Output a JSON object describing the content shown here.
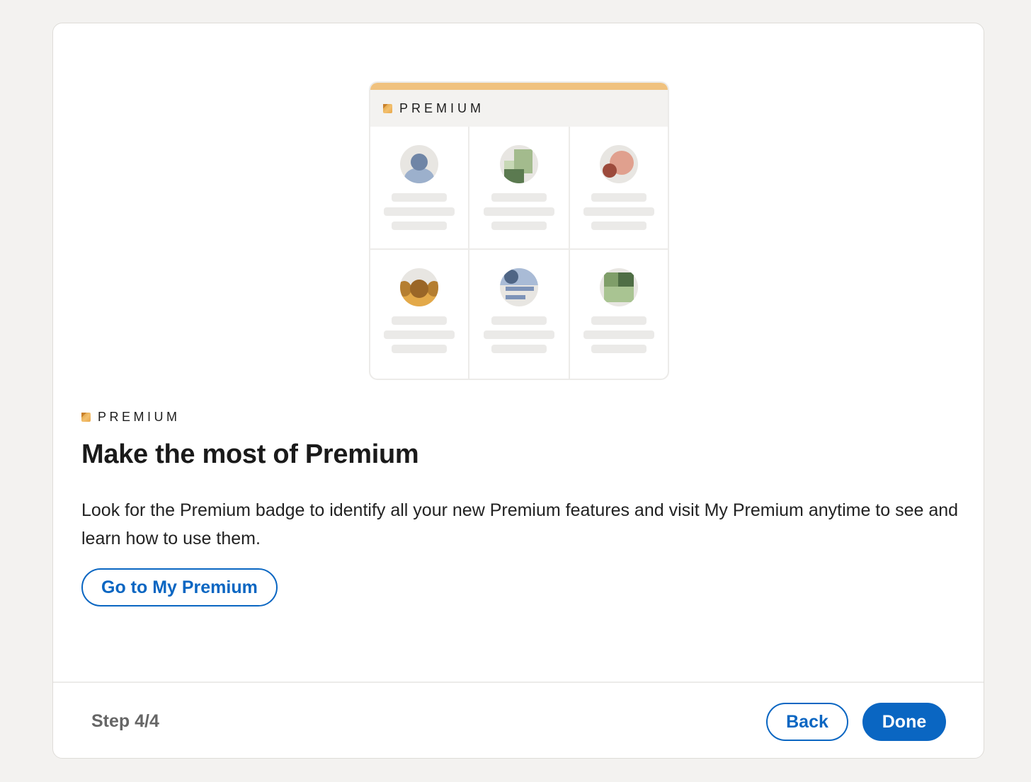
{
  "illustration": {
    "badge_label": "PREMIUM",
    "cards": [
      {
        "icon": "person-icon"
      },
      {
        "icon": "blocks-icon"
      },
      {
        "icon": "circles-icon"
      },
      {
        "icon": "bowtie-icon"
      },
      {
        "icon": "text-lines-icon"
      },
      {
        "icon": "squares-icon"
      }
    ]
  },
  "eyebrow": {
    "label": "PREMIUM",
    "icon": "premium-gem-icon"
  },
  "headline": "Make the most of Premium",
  "description": "Look for the Premium badge to identify all your new Premium features and visit My Premium anytime to see and learn how to use them.",
  "primary_link": {
    "label": "Go to My Premium"
  },
  "footer": {
    "step": "Step 4/4",
    "back_label": "Back",
    "done_label": "Done"
  },
  "colors": {
    "accent": "#0a66c2",
    "premium_gold": "#f0c27f",
    "background": "#f3f2f0"
  }
}
